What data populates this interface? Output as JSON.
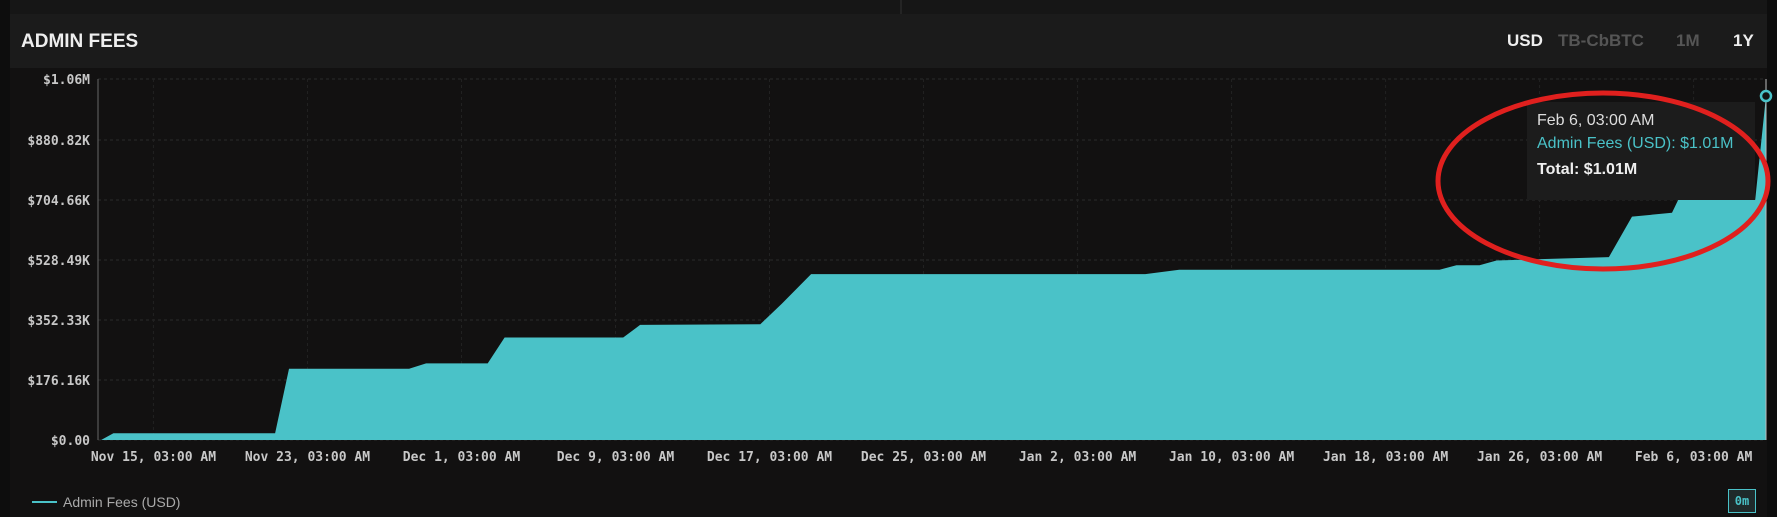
{
  "header": {
    "title": "ADMIN FEES",
    "options": [
      {
        "label": "USD",
        "active": true
      },
      {
        "label": "TB-CbBTC",
        "active": false
      },
      {
        "label": "1M",
        "active": false
      },
      {
        "label": "1Y",
        "active": true
      }
    ]
  },
  "tooltip": {
    "date": "Feb 6, 03:00 AM",
    "series_line": "Admin Fees (USD): $1.01M",
    "total": "Total: $1.01M"
  },
  "legend": {
    "label": "Admin Fees (USD)"
  },
  "zoom_button": "0m",
  "colors": {
    "series": "#4ac2c8",
    "annotation": "#e0201e"
  },
  "chart_data": {
    "type": "area",
    "title": "ADMIN FEES",
    "ylabel": "",
    "xlabel": "",
    "ylim": [
      0,
      1060000
    ],
    "yticks": [
      {
        "value": 0,
        "label": "$0.00"
      },
      {
        "value": 176160,
        "label": "$176.16K"
      },
      {
        "value": 352330,
        "label": "$352.33K"
      },
      {
        "value": 528490,
        "label": "$528.49K"
      },
      {
        "value": 704660,
        "label": "$704.66K"
      },
      {
        "value": 880820,
        "label": "$880.82K"
      },
      {
        "value": 1060000,
        "label": "$1.06M"
      }
    ],
    "xlim": [
      -0.36,
      10.47
    ],
    "xticks": [
      {
        "value": 0,
        "label": "Nov 15, 03:00 AM"
      },
      {
        "value": 1,
        "label": "Nov 23, 03:00 AM"
      },
      {
        "value": 2,
        "label": "Dec 1, 03:00 AM"
      },
      {
        "value": 3,
        "label": "Dec 9, 03:00 AM"
      },
      {
        "value": 4,
        "label": "Dec 17, 03:00 AM"
      },
      {
        "value": 5,
        "label": "Dec 25, 03:00 AM"
      },
      {
        "value": 6,
        "label": "Jan 2, 03:00 AM"
      },
      {
        "value": 7,
        "label": "Jan 10, 03:00 AM"
      },
      {
        "value": 8,
        "label": "Jan 18, 03:00 AM"
      },
      {
        "value": 9,
        "label": "Jan 26, 03:00 AM"
      },
      {
        "value": 10,
        "label": "Feb 6, 03:00 AM"
      }
    ],
    "series": [
      {
        "name": "Admin Fees (USD)",
        "points": [
          [
            -0.34,
            0
          ],
          [
            -0.26,
            20000
          ],
          [
            0.79,
            20000
          ],
          [
            0.88,
            209000
          ],
          [
            1.66,
            209000
          ],
          [
            1.77,
            225000
          ],
          [
            2.17,
            225000
          ],
          [
            2.28,
            301000
          ],
          [
            3.05,
            301000
          ],
          [
            3.16,
            338000
          ],
          [
            3.94,
            340000
          ],
          [
            4.08,
            400000
          ],
          [
            4.27,
            487000
          ],
          [
            6.44,
            487000
          ],
          [
            6.66,
            500000
          ],
          [
            8.35,
            500000
          ],
          [
            8.46,
            513000
          ],
          [
            8.61,
            513000
          ],
          [
            8.72,
            527000
          ],
          [
            9.45,
            537000
          ],
          [
            9.6,
            656000
          ],
          [
            9.86,
            667000
          ],
          [
            9.9,
            705000
          ],
          [
            10.4,
            705000
          ],
          [
            10.47,
            1010000
          ]
        ]
      }
    ]
  }
}
